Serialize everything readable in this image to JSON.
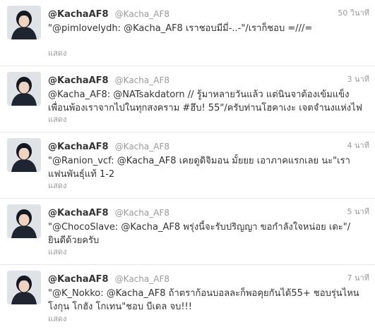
{
  "tweets": [
    {
      "name": "@KachaAF8",
      "handle": "@Kacha_AF8",
      "time": "50 วินาที",
      "text": "\"@pimlovelydh: @Kacha_AF8 เราชอบมีมี่-..-\"/เราก็ชอบ =///=",
      "action": "แสดง"
    },
    {
      "name": "@KachaAF8",
      "handle": "@Kacha_AF8",
      "time": "3 นาที",
      "text": "@Kacha_AF8: @NATsakdatorn // รู้มาหลายวันแล้ว แต่นินจาต้องเข้มแข็ง เพื่อนพ้องเราจากไปในทุกสงคราม #ฮึบ! 55\"/ครับท่านโฮคาเงะ เจตจำนงแห่งไฟ",
      "action": "แสดง"
    },
    {
      "name": "@KachaAF8",
      "handle": "@Kacha_AF8",
      "time": "4 นาที",
      "text": "\"@Ranion_vcf: @Kacha_AF8 เคยดูดิจิมอน มั้ยยย เอาภาคแรกเลย นะ\"เราแฟนพันธุ์แท้ 1-2",
      "action": "แสดง"
    },
    {
      "name": "@KachaAF8",
      "handle": "@Kacha_AF8",
      "time": "5 นาที",
      "text": "\"@ChocoSlave: @Kacha_AF8 พรุ่งนี้จะรับปริญญา ขอกำลังใจหน่อย เดะ\"/ยินดีด้วยครับ",
      "action": "แสดง"
    },
    {
      "name": "@KachaAF8",
      "handle": "@Kacha_AF8",
      "time": "7 นาที",
      "text": "\"@K_Nokko: @Kacha_AF8 ถ้าตราก้อนบอลละก็พอคุยกันได้55+ ชอบรุ่นไหน โงกุน โกฮัง โกเทน\"ชอบ บีเดล จบ!!!",
      "action": "แสดง"
    }
  ]
}
